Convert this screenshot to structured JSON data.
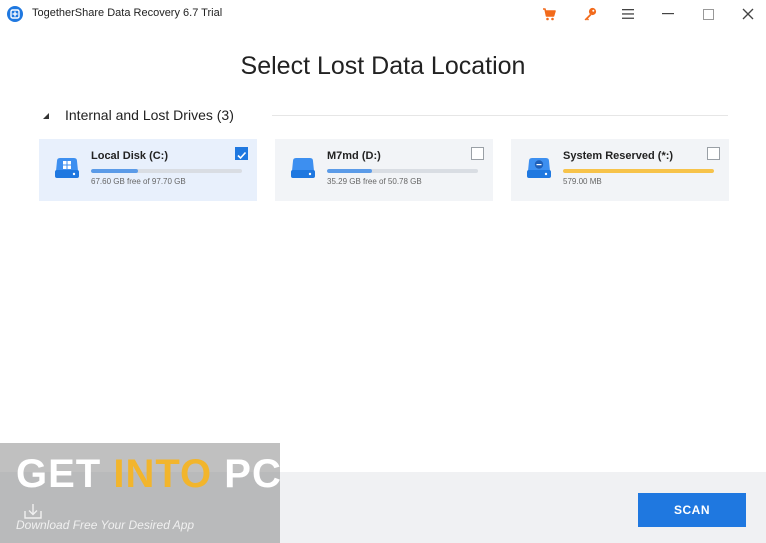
{
  "window": {
    "title": "TogetherShare Data Recovery 6.7 Trial",
    "icons": [
      "app-logo-icon",
      "cart-icon",
      "key-icon",
      "menu-icon",
      "minimize-icon",
      "maximize-icon",
      "close-icon"
    ]
  },
  "main": {
    "title": "Select Lost Data Location",
    "section": {
      "title": "Internal and Lost Drives (3)",
      "collapsed": false
    },
    "drives": [
      {
        "name": "Local Disk (C:)",
        "size": "67.60 GB free of 97.70 GB",
        "used_fraction": 0.31,
        "bar_color": "#5b9be8",
        "checked": true,
        "icon": "windows-drive-icon"
      },
      {
        "name": "M7md (D:)",
        "size": "35.29 GB free of 50.78 GB",
        "used_fraction": 0.3,
        "bar_color": "#5b9be8",
        "checked": false,
        "icon": "drive-icon"
      },
      {
        "name": "System Reserved (*:)",
        "size": "579.00 MB",
        "used_fraction": 1.0,
        "bar_color": "#f7c34a",
        "checked": false,
        "icon": "system-drive-icon"
      }
    ]
  },
  "footer": {
    "scan_label": "SCAN"
  },
  "watermark": {
    "text_part1": "GET ",
    "text_part2": "INTO",
    "text_part3": " PC",
    "subtitle": "Download Free Your Desired App"
  },
  "colors": {
    "accent": "#1f78e0",
    "icon_orange": "#f26a1b"
  }
}
